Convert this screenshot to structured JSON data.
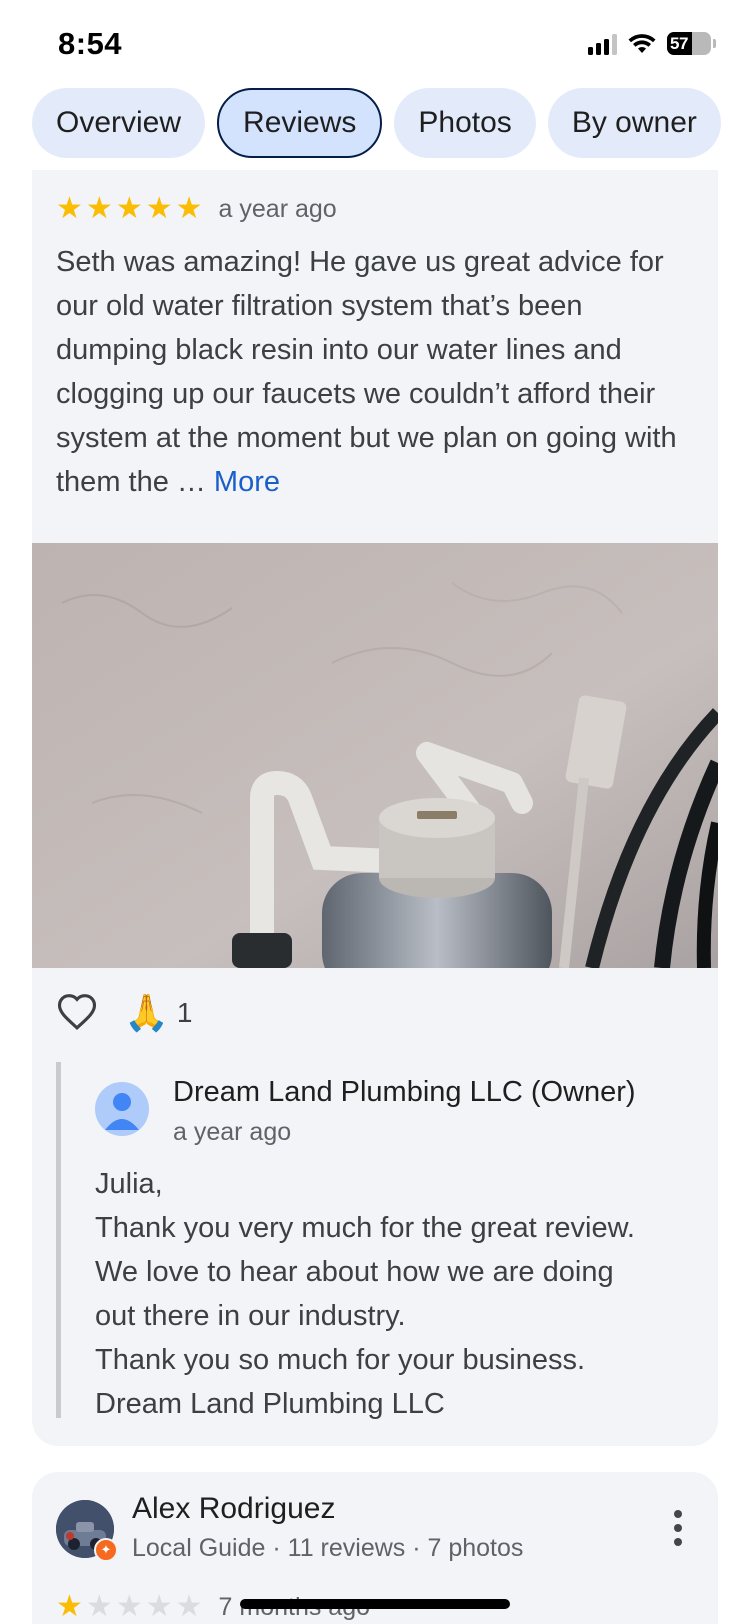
{
  "status_bar": {
    "time": "8:54",
    "battery": "57",
    "battery_level": 0.57
  },
  "tabs": [
    {
      "label": "Overview",
      "active": false
    },
    {
      "label": "Reviews",
      "active": true
    },
    {
      "label": "Photos",
      "active": false
    },
    {
      "label": "By owner",
      "active": false
    }
  ],
  "review1": {
    "rating": 5,
    "time": "a year ago",
    "text": "Seth was amazing! He gave us great advice for our old water filtration system that’s been dumping black resin into our water lines and clogging up our faucets we couldn’t afford their system at the moment but we plan on going with them the …",
    "more_label": "More",
    "reaction_emoji": "🙏",
    "reaction_count": "1",
    "owner_reply": {
      "name": "Dream Land Plumbing LLC (Owner)",
      "time": "a year ago",
      "lines": [
        "Julia,",
        "Thank you very much for the great review.",
        "We love to hear about how we are doing",
        "out there in our industry.",
        "Thank you so much for your business.",
        "Dream Land Plumbing LLC"
      ]
    }
  },
  "review2": {
    "name": "Alex Rodriguez",
    "subtitle": "Local Guide · 11 reviews · 7 photos",
    "rating": 1,
    "time": "7 months ago"
  },
  "colors": {
    "accent": "#1a5fc9",
    "star": "#fbbc04",
    "card": "#f2f4f7",
    "tab": "#e3ebfa"
  }
}
